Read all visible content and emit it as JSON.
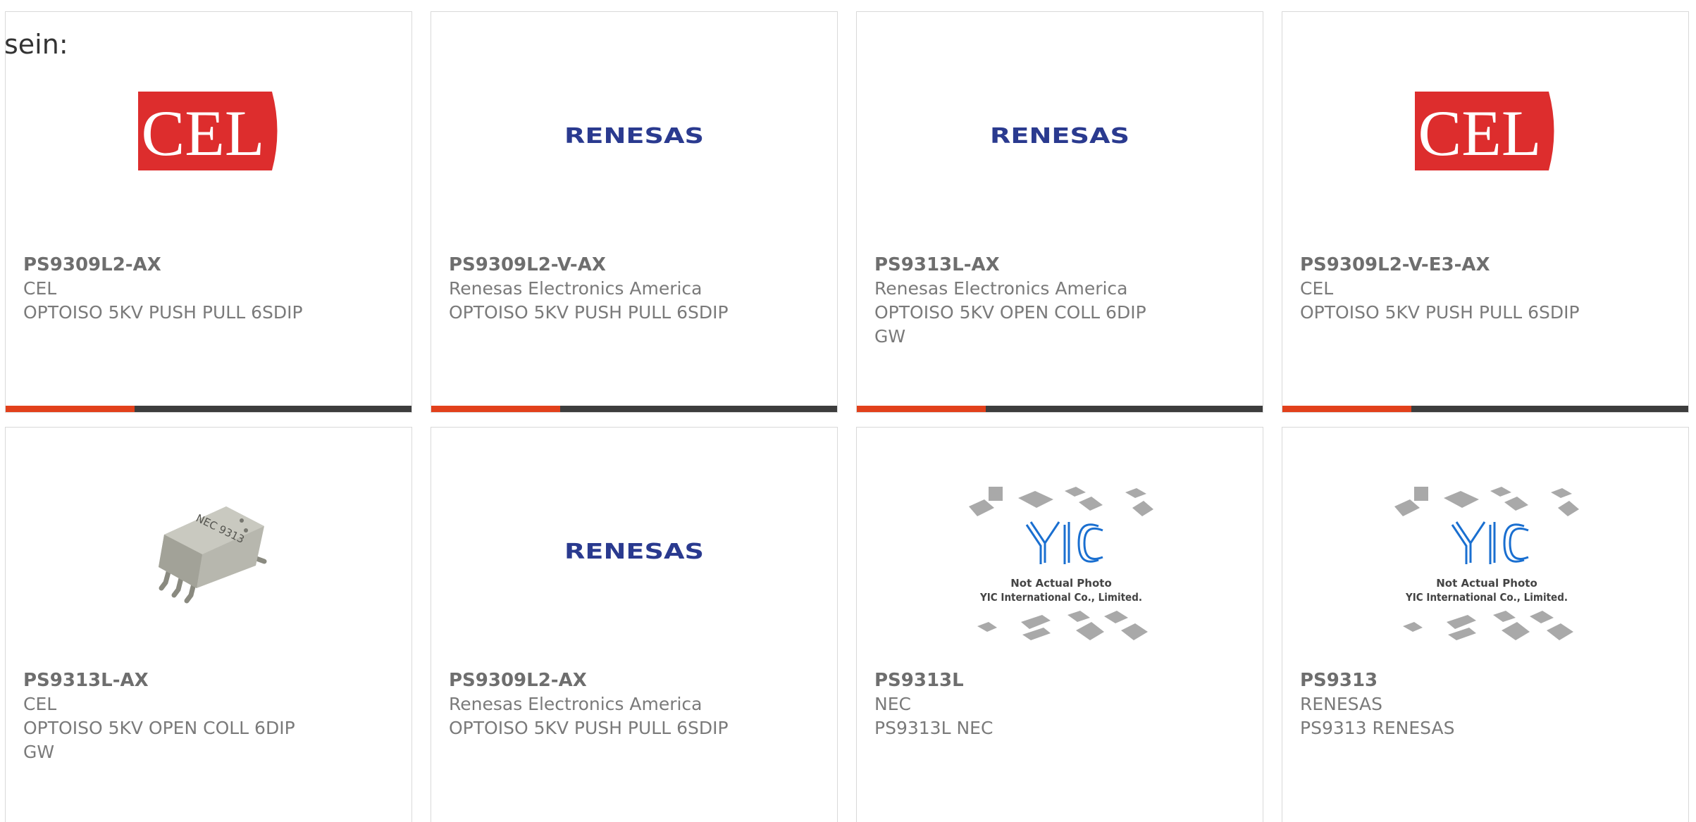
{
  "intro_text": "sein:",
  "colors": {
    "accent": "#e2401b",
    "bar": "#3d3d3d",
    "cel_red": "#dd2d2d",
    "renesas_blue": "#2a3a8f",
    "yic_blue": "#1a6fd0"
  },
  "products": [
    {
      "part_number": "PS9309L2-AX",
      "manufacturer": "CEL",
      "description": "OPTOISO 5KV PUSH PULL 6SDIP",
      "image": "cel-logo",
      "logo_text": "CEL"
    },
    {
      "part_number": "PS9309L2-V-AX",
      "manufacturer": "Renesas Electronics America",
      "description": "OPTOISO 5KV PUSH PULL 6SDIP",
      "image": "renesas-logo",
      "logo_text": "RENESAS"
    },
    {
      "part_number": "PS9313L-AX",
      "manufacturer": "Renesas Electronics America",
      "description": "OPTOISO 5KV OPEN COLL 6DIP GW",
      "image": "renesas-logo",
      "logo_text": "RENESAS"
    },
    {
      "part_number": "PS9309L2-V-E3-AX",
      "manufacturer": "CEL",
      "description": "OPTOISO 5KV PUSH PULL 6SDIP",
      "image": "cel-logo",
      "logo_text": "CEL"
    },
    {
      "part_number": "PS9313L-AX",
      "manufacturer": "CEL",
      "description": "OPTOISO 5KV OPEN COLL 6DIP GW",
      "image": "chip-photo",
      "logo_text": "NEC 9313"
    },
    {
      "part_number": "PS9309L2-AX",
      "manufacturer": "Renesas Electronics America",
      "description": "OPTOISO 5KV PUSH PULL 6SDIP",
      "image": "renesas-logo",
      "logo_text": "RENESAS"
    },
    {
      "part_number": "PS9313L",
      "manufacturer": "NEC",
      "description": "PS9313L NEC",
      "image": "yic-photo",
      "logo_text": "YIC",
      "photo_line1": "Not Actual Photo",
      "photo_line2": "YIC International Co., Limited."
    },
    {
      "part_number": "PS9313",
      "manufacturer": "RENESAS",
      "description": "PS9313 RENESAS",
      "image": "yic-photo",
      "logo_text": "YIC",
      "photo_line1": "Not Actual Photo",
      "photo_line2": "YIC International Co., Limited."
    }
  ]
}
